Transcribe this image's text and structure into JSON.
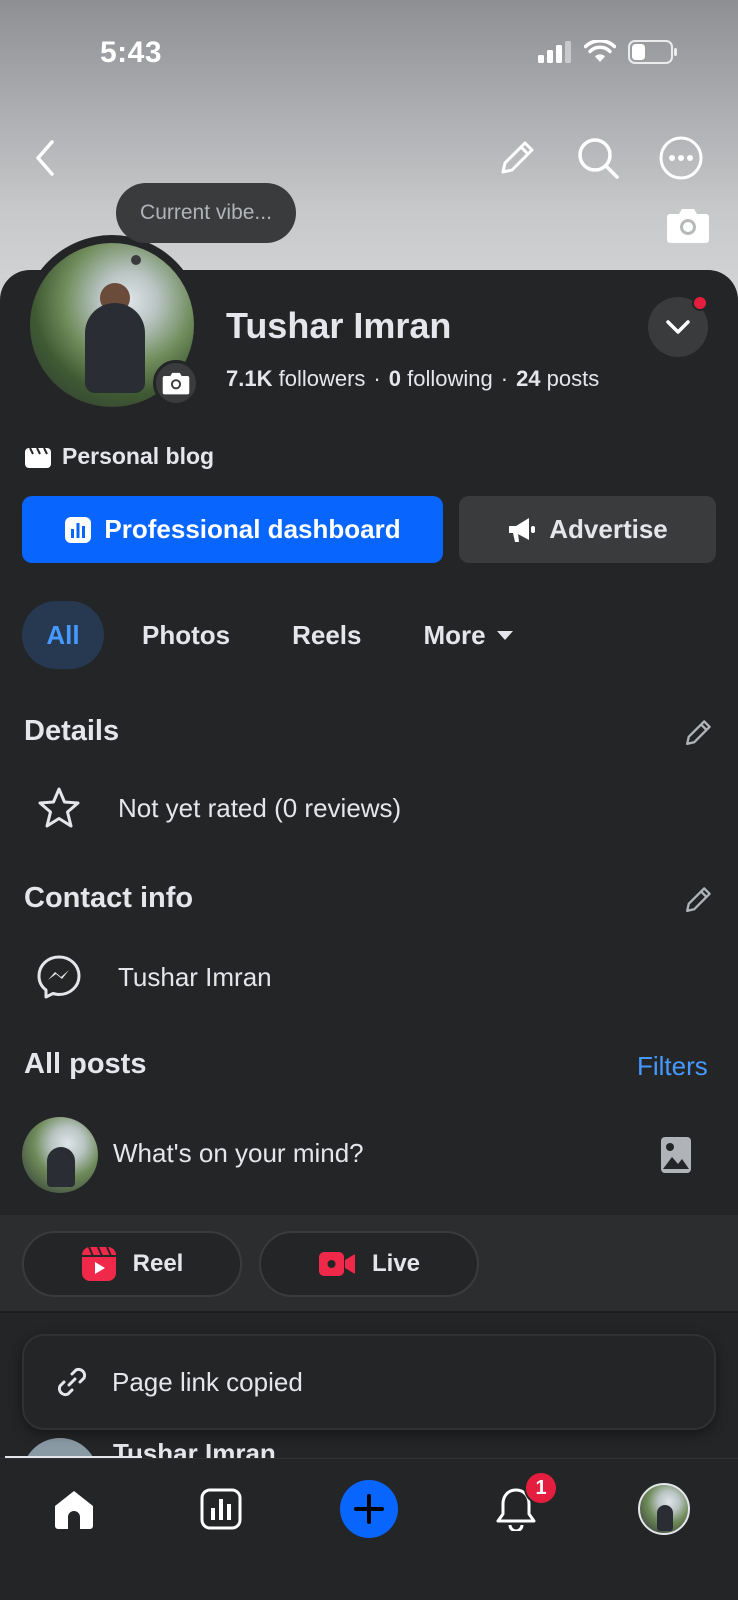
{
  "status_bar": {
    "time": "5:43"
  },
  "profile": {
    "status_tooltip": "Current vibe...",
    "name": "Tushar Imran",
    "followers_count": "7.1K",
    "followers_label": "followers",
    "following_count": "0",
    "following_label": "following",
    "posts_count": "24",
    "posts_label": "posts",
    "category": "Personal blog"
  },
  "actions": {
    "dashboard_label": "Professional dashboard",
    "advertise_label": "Advertise"
  },
  "tabs": [
    {
      "label": "All",
      "active": true
    },
    {
      "label": "Photos",
      "active": false
    },
    {
      "label": "Reels",
      "active": false
    },
    {
      "label": "More",
      "active": false
    }
  ],
  "details": {
    "title": "Details",
    "rating_text": "Not yet rated (0 reviews)"
  },
  "contact": {
    "title": "Contact info",
    "messenger_name": "Tushar Imran"
  },
  "posts": {
    "title": "All posts",
    "filters_label": "Filters",
    "composer_placeholder": "What's on your mind?",
    "reel_label": "Reel",
    "live_label": "Live"
  },
  "toast": {
    "message": "Page link copied"
  },
  "partial_post": {
    "author": "Tushar Imran"
  },
  "bottom_nav": {
    "notification_count": "1"
  },
  "colors": {
    "accent": "#0866ff",
    "link": "#4599ff",
    "badge": "#e41e3f",
    "background": "#242526",
    "surface": "#3a3b3c"
  }
}
